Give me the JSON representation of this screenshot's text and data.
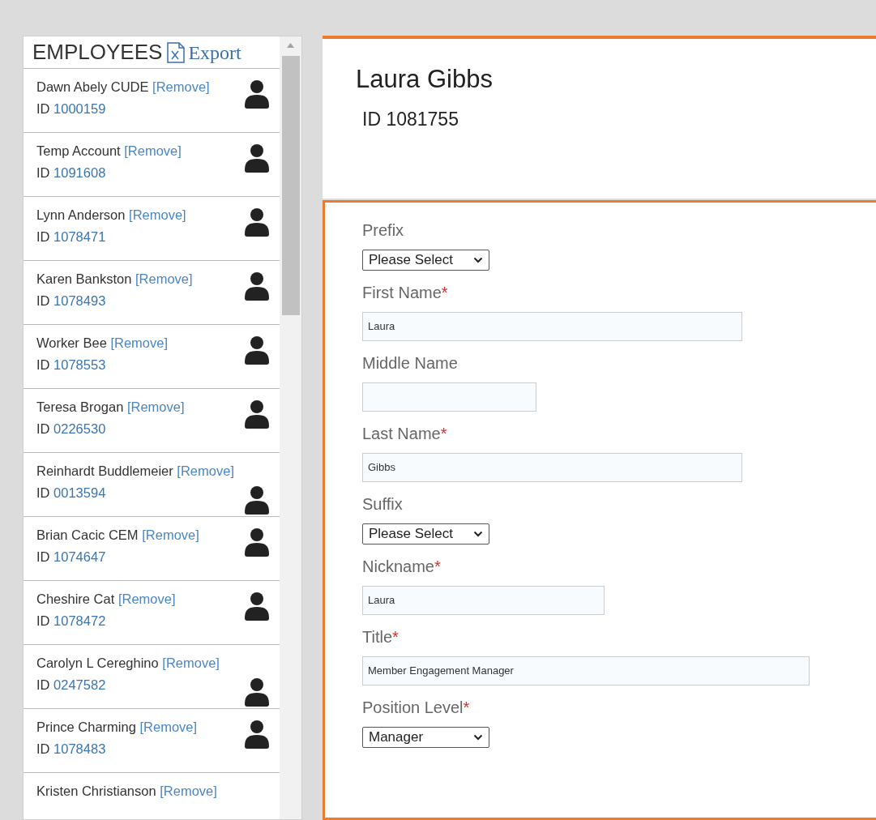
{
  "employees_panel": {
    "title": "EMPLOYEES",
    "export": "Export"
  },
  "employees": [
    {
      "name": "Dawn Abely CUDE",
      "remove": "[Remove]",
      "id_label": "ID",
      "id": "1000159"
    },
    {
      "name": "Temp Account",
      "remove": "[Remove]",
      "id_label": "ID",
      "id": "1091608"
    },
    {
      "name": "Lynn Anderson",
      "remove": "[Remove]",
      "id_label": "ID",
      "id": "1078471"
    },
    {
      "name": "Karen Bankston",
      "remove": "[Remove]",
      "id_label": "ID",
      "id": "1078493"
    },
    {
      "name": "Worker Bee",
      "remove": "[Remove]",
      "id_label": "ID",
      "id": "1078553"
    },
    {
      "name": "Teresa Brogan",
      "remove": "[Remove]",
      "id_label": "ID",
      "id": "0226530"
    },
    {
      "name": "Reinhardt Buddlemeier",
      "remove": "[Remove]",
      "id_label": "ID",
      "id": "0013594"
    },
    {
      "name": "Brian Cacic CEM",
      "remove": "[Remove]",
      "id_label": "ID",
      "id": "1074647"
    },
    {
      "name": "Cheshire Cat",
      "remove": "[Remove]",
      "id_label": "ID",
      "id": "1078472"
    },
    {
      "name": "Carolyn L Cereghino",
      "remove": "[Remove]",
      "id_label": "ID",
      "id": "0247582"
    },
    {
      "name": "Prince Charming",
      "remove": "[Remove]",
      "id_label": "ID",
      "id": "1078483"
    },
    {
      "name": "Kristen Christianson",
      "remove": "[Remove]"
    }
  ],
  "profile": {
    "name": "Laura Gibbs",
    "id": "ID 1081755"
  },
  "fields": [
    {
      "kind": "select",
      "label": "Prefix",
      "value": "Please Select"
    },
    {
      "kind": "text",
      "label": "First Name",
      "required_mark": "*",
      "value": "Laura"
    },
    {
      "kind": "text",
      "label": "Middle Name"
    },
    {
      "kind": "text",
      "label": "Last Name",
      "required_mark": "*",
      "value": "Gibbs"
    },
    {
      "kind": "select",
      "label": "Suffix",
      "value": "Please Select"
    },
    {
      "kind": "text",
      "label": "Nickname",
      "required_mark": "*",
      "value": "Laura"
    },
    {
      "kind": "text",
      "label": "Title",
      "required_mark": "*",
      "value": "Member Engagement Manager"
    },
    {
      "kind": "select",
      "label": "Position Level",
      "required_mark": "*",
      "value": "Manager"
    }
  ]
}
